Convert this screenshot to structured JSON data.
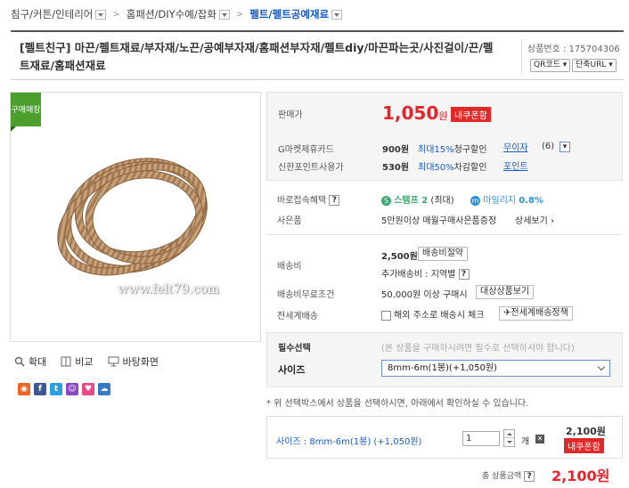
{
  "breadcrumb": [
    {
      "label": "침구/커튼/인테리어"
    },
    {
      "label": "홈패션/DIY수예/잡화"
    },
    {
      "label": "펠트/펠트공예재료"
    }
  ],
  "product": {
    "title": "[펠트친구] 마끈/펠트재료/부자재/노끈/공예부자재/홈패션부자재/펠트diy/마끈파는곳/사진걸이/끈/펠트재료/홈패션재료",
    "number_label": "상품번호 : 175704306",
    "qr_label": "QR코드",
    "url_label": "단축URL",
    "ribbon": "구매매장",
    "watermark": "www.felt79.com"
  },
  "tools": {
    "zoom": "확대",
    "compare": "비교",
    "desktop": "바탕화면"
  },
  "price": {
    "label": "판매가",
    "value": "1,050",
    "unit": "원",
    "coupon": "내쿠폰함"
  },
  "cards": [
    {
      "label": "G마켓제휴카드",
      "amount": "900원",
      "rate": "최대15%",
      "desc": "청구할인",
      "link": "무이자",
      "count": "(6)"
    },
    {
      "label": "신한포인트사용가",
      "amount": "530원",
      "rate": "최대50%",
      "desc": "차감할인",
      "link": "포인트"
    }
  ],
  "benefit": {
    "label": "바로접속혜택",
    "stamp": "스탬프 2",
    "stamp_note": "(최대)",
    "mileage": "마일리지",
    "mileage_rate": "0.8%"
  },
  "gift": {
    "label": "사은품",
    "text": "5만원이상 매월구매사은품증정",
    "link": "상세보기"
  },
  "shipping": {
    "label": "배송비",
    "fee": "2,500원",
    "fee_btn": "배송비절약",
    "extra": "추가배송비 : 지역별",
    "free_label": "배송비무료조건",
    "free_text": "50,000원 이상 구매시",
    "free_btn": "대상상품보기",
    "global_label": "전세계배송",
    "global_text": "해외 주소로 배송시 체크",
    "global_btn": "전세계배송정책"
  },
  "options": {
    "required_label": "필수선택",
    "required_note": "(본 상품을 구매하시려면 필수로 선택하셔야 합니다)",
    "size_label": "사이즈",
    "size_value": "8mm-6m(1봉)(+1,050원)"
  },
  "note": "* 위 선택박스에서 상품을 선택하시면, 아래에서 확인하실 수 있습니다.",
  "selected": {
    "text": "사이즈 : 8mm-6m(1봉) (+1,050원)",
    "qty": "1",
    "unit": "개",
    "price": "2,100원",
    "coupon": "내쿠폰함"
  },
  "total": {
    "label": "총 상품금액",
    "value": "2,100원"
  },
  "colors": {
    "accent_red": "#e5242b",
    "link_blue": "#1c5dc1",
    "ribbon_green": "#4c9e2f"
  }
}
